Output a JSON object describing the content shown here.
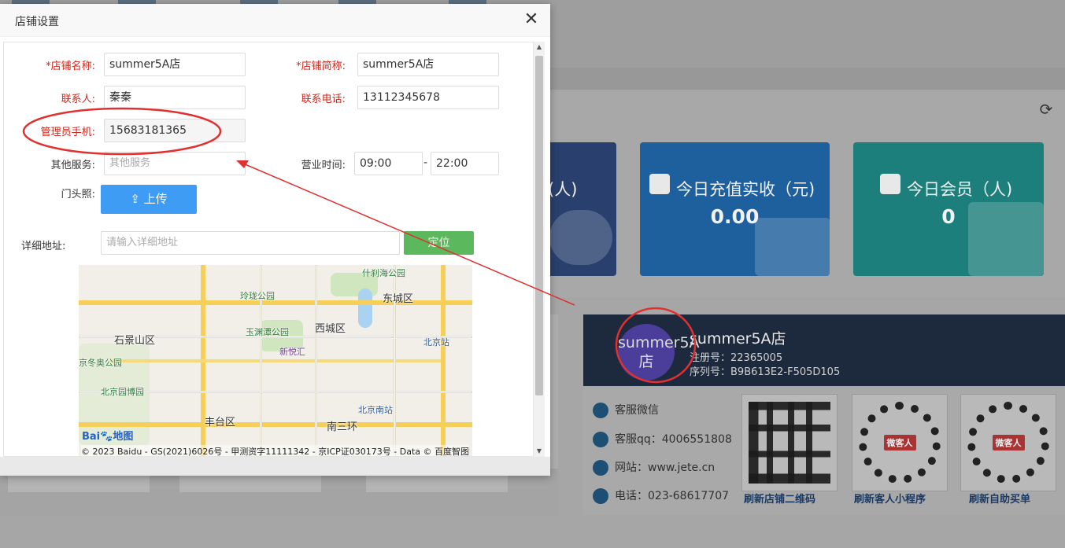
{
  "dialog": {
    "title": "店铺设置",
    "close_icon": "close-icon",
    "fields": {
      "store_name": {
        "label": "*店铺名称:",
        "value": "summer5A店"
      },
      "store_short": {
        "label": "*店铺简称:",
        "value": "summer5A店"
      },
      "contact": {
        "label": "联系人:",
        "value": "秦秦"
      },
      "phone": {
        "label": "联系电话:",
        "value": "13112345678"
      },
      "admin_phone": {
        "label": "管理员手机:",
        "value": "15683181365"
      },
      "other_service": {
        "label": "其他服务:",
        "placeholder": "其他服务"
      },
      "business_hours": {
        "label": "营业时间:",
        "start": "09:00",
        "end": "22:00",
        "separator": "-"
      },
      "storefront_photo": {
        "label": "门头照:",
        "upload_label": "上传"
      },
      "address": {
        "label": "详细地址:",
        "placeholder": "请输入详细地址",
        "locate_label": "定位"
      }
    },
    "map": {
      "places": [
        "什刹海公园",
        "玲珑公园",
        "东城区",
        "西城区",
        "玉渊潭公园",
        "石景山区",
        "新悦汇",
        "北京站",
        "京冬奥公园",
        "北京园博园",
        "丰台区",
        "北京南站",
        "南三环"
      ],
      "logo_a": "Bai",
      "logo_b": "地图",
      "copyright": "© 2023 Baidu - GS(2021)6026号 - 甲测资字11111342 - 京ICP证030173号 - Data © 百度智图"
    }
  },
  "dashboard": {
    "cards": [
      {
        "title": "(人)",
        "value": ""
      },
      {
        "title": "今日充值实收（元)",
        "value": "0.00"
      },
      {
        "title": "今日会员（人)",
        "value": "0"
      }
    ],
    "store": {
      "avatar_text": "summer5A店",
      "name": "summer5A店",
      "reg_no": "注册号：22365005",
      "serial_no": "序列号：B9B613E2-F505D105"
    },
    "contacts": [
      {
        "label": "客服微信"
      },
      {
        "label": "客服qq：4006551808"
      },
      {
        "label": "网站：www.jete.cn"
      },
      {
        "label": "电话：023-68617707"
      }
    ],
    "qrcodes": [
      {
        "link": "刷新店铺二维码"
      },
      {
        "link": "刷新客人小程序",
        "badge": "微客人"
      },
      {
        "link": "刷新自助买单",
        "badge": "微客人"
      }
    ]
  },
  "colors": {
    "required_label": "#d0271d",
    "upload_button": "#3f9cf4",
    "locate_button": "#5cb85c",
    "annotation": "#e03030"
  }
}
